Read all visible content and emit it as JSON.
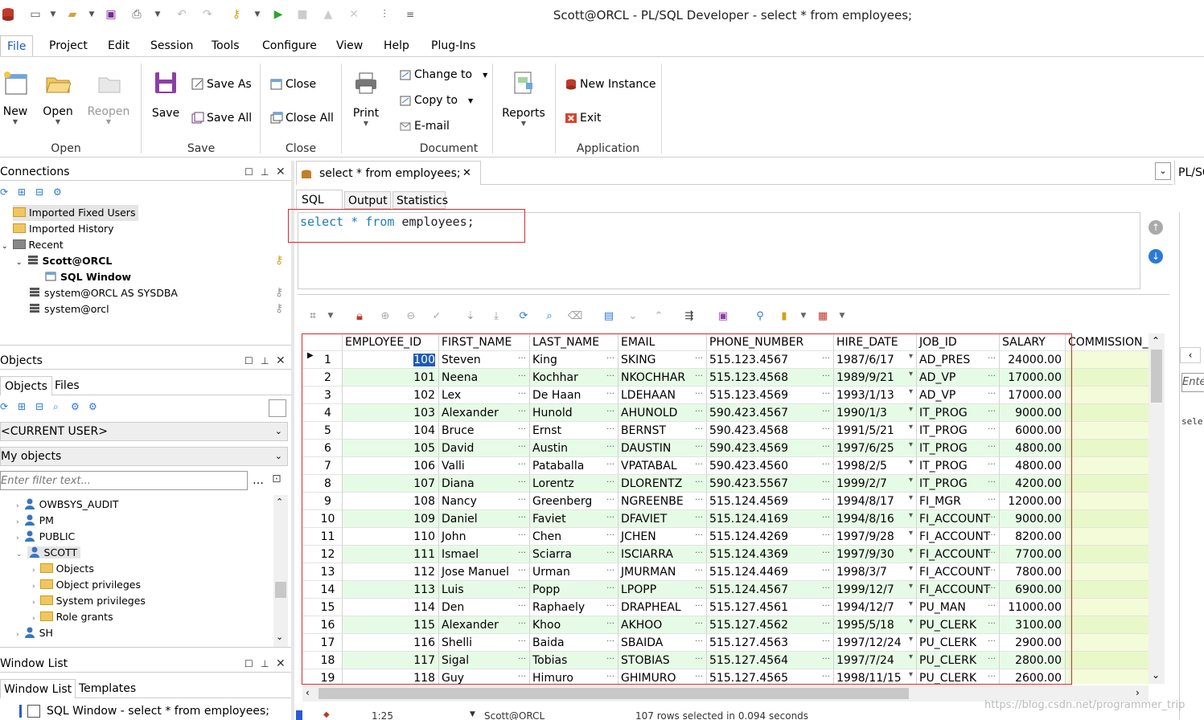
{
  "app": {
    "title": "Scott@ORCL - PL/SQL Developer - select * from employees;"
  },
  "menu": [
    "File",
    "Project",
    "Edit",
    "Session",
    "Tools",
    "Configure",
    "View",
    "Help",
    "Plug-Ins"
  ],
  "ribbon": {
    "new": "New",
    "open": "Open",
    "reopen": "Reopen",
    "save": "Save",
    "save_as": "Save As",
    "save_all": "Save All",
    "close": "Close",
    "close_all": "Close All",
    "print": "Print",
    "change_to": "Change to",
    "copy_to": "Copy to",
    "email": "E-mail",
    "reports": "Reports",
    "new_instance": "New Instance",
    "exit": "Exit",
    "groups": [
      "Open",
      "Save",
      "Close",
      "Document",
      "Application"
    ]
  },
  "connections": {
    "title": "Connections",
    "items": [
      {
        "label": "Imported Fixed Users"
      },
      {
        "label": "Imported History"
      },
      {
        "label": "Recent"
      },
      {
        "label": "Scott@ORCL"
      },
      {
        "label": "SQL Window"
      },
      {
        "label": "system@ORCL AS SYSDBA"
      },
      {
        "label": "system@orcl"
      }
    ]
  },
  "objects": {
    "title": "Objects",
    "tabs": [
      "Objects",
      "Files"
    ],
    "user_select": "<CURRENT USER>",
    "scope_select": "My objects",
    "filter_placeholder": "Enter filter text...",
    "tree": [
      "OWBSYS_AUDIT",
      "PM",
      "PUBLIC",
      "SCOTT",
      "Objects",
      "Object privileges",
      "System privileges",
      "Role grants",
      "SH"
    ]
  },
  "windowlist": {
    "title": "Window List",
    "tabs": [
      "Window List",
      "Templates"
    ],
    "items": [
      "SQL Window - select * from employees;"
    ]
  },
  "editor": {
    "doc_tab": "select * from employees;",
    "tabs": [
      "SQL",
      "Output",
      "Statistics"
    ],
    "sql": {
      "kw1": "select",
      "star": "*",
      "kw2": "from",
      "table": "employees;"
    },
    "right_tab": "PL/SQ",
    "right_input": "Ente",
    "right_text": "sele"
  },
  "grid": {
    "columns": [
      "EMPLOYEE_ID",
      "FIRST_NAME",
      "LAST_NAME",
      "EMAIL",
      "PHONE_NUMBER",
      "HIRE_DATE",
      "JOB_ID",
      "SALARY",
      "COMMISSION_"
    ],
    "rows": [
      [
        "1",
        "100",
        "Steven",
        "King",
        "SKING",
        "515.123.4567",
        "1987/6/17",
        "AD_PRES",
        "24000.00"
      ],
      [
        "2",
        "101",
        "Neena",
        "Kochhar",
        "NKOCHHAR",
        "515.123.4568",
        "1989/9/21",
        "AD_VP",
        "17000.00"
      ],
      [
        "3",
        "102",
        "Lex",
        "De Haan",
        "LDEHAAN",
        "515.123.4569",
        "1993/1/13",
        "AD_VP",
        "17000.00"
      ],
      [
        "4",
        "103",
        "Alexander",
        "Hunold",
        "AHUNOLD",
        "590.423.4567",
        "1990/1/3",
        "IT_PROG",
        "9000.00"
      ],
      [
        "5",
        "104",
        "Bruce",
        "Ernst",
        "BERNST",
        "590.423.4568",
        "1991/5/21",
        "IT_PROG",
        "6000.00"
      ],
      [
        "6",
        "105",
        "David",
        "Austin",
        "DAUSTIN",
        "590.423.4569",
        "1997/6/25",
        "IT_PROG",
        "4800.00"
      ],
      [
        "7",
        "106",
        "Valli",
        "Pataballa",
        "VPATABAL",
        "590.423.4560",
        "1998/2/5",
        "IT_PROG",
        "4800.00"
      ],
      [
        "8",
        "107",
        "Diana",
        "Lorentz",
        "DLORENTZ",
        "590.423.5567",
        "1999/2/7",
        "IT_PROG",
        "4200.00"
      ],
      [
        "9",
        "108",
        "Nancy",
        "Greenberg",
        "NGREENBE",
        "515.124.4569",
        "1994/8/17",
        "FI_MGR",
        "12000.00"
      ],
      [
        "10",
        "109",
        "Daniel",
        "Faviet",
        "DFAVIET",
        "515.124.4169",
        "1994/8/16",
        "FI_ACCOUNT",
        "9000.00"
      ],
      [
        "11",
        "110",
        "John",
        "Chen",
        "JCHEN",
        "515.124.4269",
        "1997/9/28",
        "FI_ACCOUNT",
        "8200.00"
      ],
      [
        "12",
        "111",
        "Ismael",
        "Sciarra",
        "ISCIARRA",
        "515.124.4369",
        "1997/9/30",
        "FI_ACCOUNT",
        "7700.00"
      ],
      [
        "13",
        "112",
        "Jose Manuel",
        "Urman",
        "JMURMAN",
        "515.124.4469",
        "1998/3/7",
        "FI_ACCOUNT",
        "7800.00"
      ],
      [
        "14",
        "113",
        "Luis",
        "Popp",
        "LPOPP",
        "515.124.4567",
        "1999/12/7",
        "FI_ACCOUNT",
        "6900.00"
      ],
      [
        "15",
        "114",
        "Den",
        "Raphaely",
        "DRAPHEAL",
        "515.127.4561",
        "1994/12/7",
        "PU_MAN",
        "11000.00"
      ],
      [
        "16",
        "115",
        "Alexander",
        "Khoo",
        "AKHOO",
        "515.127.4562",
        "1995/5/18",
        "PU_CLERK",
        "3100.00"
      ],
      [
        "17",
        "116",
        "Shelli",
        "Baida",
        "SBAIDA",
        "515.127.4563",
        "1997/12/24",
        "PU_CLERK",
        "2900.00"
      ],
      [
        "18",
        "117",
        "Sigal",
        "Tobias",
        "STOBIAS",
        "515.127.4564",
        "1997/7/24",
        "PU_CLERK",
        "2800.00"
      ],
      [
        "19",
        "118",
        "Guy",
        "Himuro",
        "GHIMURO",
        "515.127.4565",
        "1998/11/15",
        "PU_CLERK",
        "2600.00"
      ]
    ]
  },
  "status": {
    "position": "1:25",
    "connection": "Scott@ORCL",
    "message": "107 rows selected in 0.094 seconds"
  },
  "watermark": "https://blog.csdn.net/programmer_trip",
  "colors": {
    "accent": "#1e5bb7",
    "row_alt": "#e6fbe6",
    "highlight": "#d62a2a",
    "sql_kw": "#1c7cb4"
  }
}
